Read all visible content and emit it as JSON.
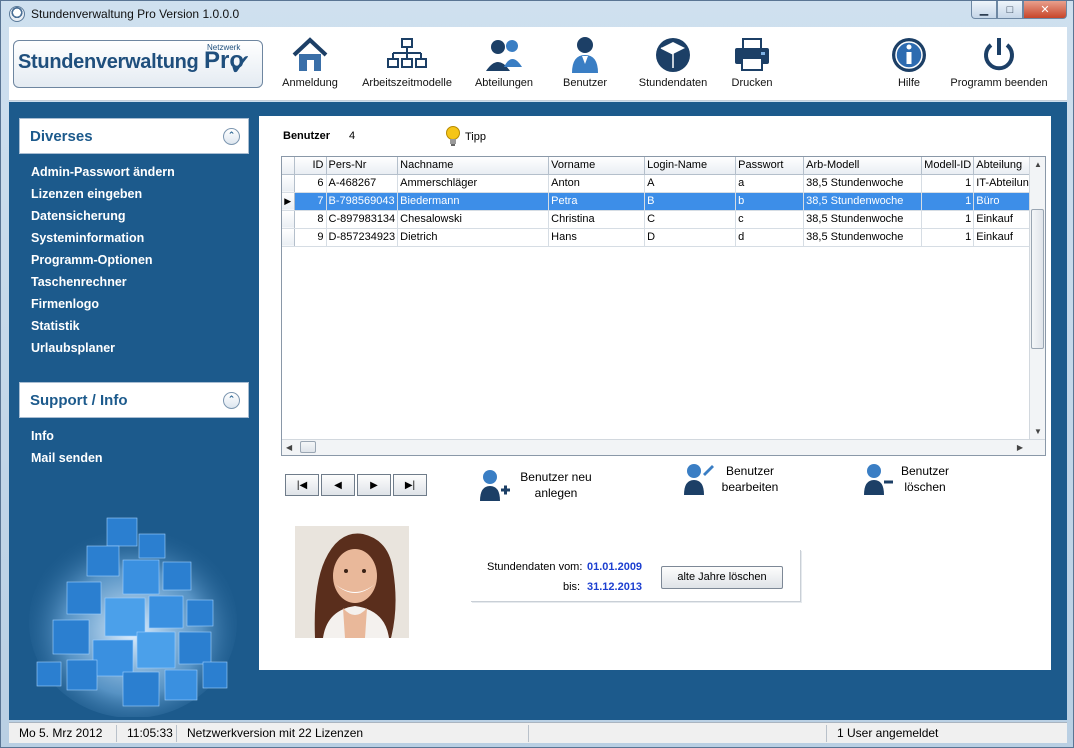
{
  "window": {
    "title": "Stundenverwaltung Pro Version 1.0.0.0"
  },
  "logo": {
    "main": "Stundenverwaltung",
    "pro": "Pro",
    "badge": "Netzwerk"
  },
  "toolbar": {
    "items": [
      {
        "label": "Anmeldung",
        "icon": "home-icon"
      },
      {
        "label": "Arbeitszeitmodelle",
        "icon": "org-chart-icon"
      },
      {
        "label": "Abteilungen",
        "icon": "users-group-icon"
      },
      {
        "label": "Benutzer",
        "icon": "user-icon"
      },
      {
        "label": "Stundendaten",
        "icon": "cube-icon"
      },
      {
        "label": "Drucken",
        "icon": "printer-icon"
      },
      {
        "label": "Hilfe",
        "icon": "info-icon"
      },
      {
        "label": "Programm beenden",
        "icon": "power-icon"
      }
    ]
  },
  "sidebar": {
    "diverses": {
      "title": "Diverses",
      "items": [
        "Admin-Passwort ändern",
        "Lizenzen eingeben",
        "Datensicherung",
        "Systeminformation",
        "Programm-Optionen",
        "Taschenrechner",
        "Firmenlogo",
        "Statistik",
        "Urlaubsplaner"
      ]
    },
    "support": {
      "title": "Support / Info",
      "items": [
        "Info",
        "Mail senden"
      ]
    }
  },
  "main": {
    "benutzer_label": "Benutzer",
    "benutzer_count": "4",
    "tipp": "Tipp",
    "table": {
      "columns": [
        "ID",
        "Pers-Nr",
        "Nachname",
        "Vorname",
        "Login-Name",
        "Passwort",
        "Arb-Modell",
        "Modell-ID",
        "Abteilung"
      ],
      "rows": [
        [
          "6",
          "A-468267",
          "Ammerschläger",
          "Anton",
          "A",
          "a",
          "38,5 Stundenwoche",
          "1",
          "IT-Abteilung"
        ],
        [
          "7",
          "B-798569043",
          "Biedermann",
          "Petra",
          "B",
          "b",
          "38,5 Stundenwoche",
          "1",
          "Büro"
        ],
        [
          "8",
          "C-897983134",
          "Chesalowski",
          "Christina",
          "C",
          "c",
          "38,5 Stundenwoche",
          "1",
          "Einkauf"
        ],
        [
          "9",
          "D-857234923",
          "Dietrich",
          "Hans",
          "D",
          "d",
          "38,5 Stundenwoche",
          "1",
          "Einkauf"
        ]
      ],
      "selected_row": 1
    },
    "actions": {
      "new": "Benutzer neu anlegen",
      "edit": "Benutzer bearbeiten",
      "delete": "Benutzer löschen"
    },
    "dates": {
      "from_label": "Stundendaten vom:",
      "from_value": "01.01.2009",
      "to_label": "bis:",
      "to_value": "31.12.2013",
      "button": "alte Jahre löschen"
    }
  },
  "statusbar": {
    "date": "Mo 5. Mrz  2012",
    "time": "11:05:33",
    "license": "Netzwerkversion mit 22 Lizenzen",
    "users": "1 User angemeldet"
  }
}
